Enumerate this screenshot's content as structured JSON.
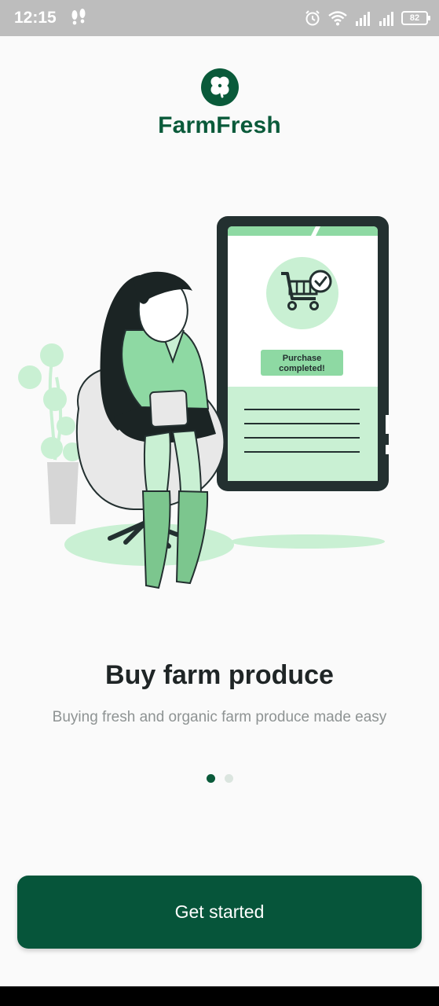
{
  "status_bar": {
    "time": "12:15",
    "battery": "82",
    "icons": [
      "footsteps-icon",
      "alarm-icon",
      "wifi-icon",
      "signal-icon",
      "signal-icon",
      "battery-icon"
    ]
  },
  "brand": {
    "name": "FarmFresh",
    "icon": "clover-icon",
    "color": "#0a5a3a"
  },
  "illustration": {
    "badge_line1": "Purchase",
    "badge_line2": "completed!",
    "icon": "shopping-cart-check-icon"
  },
  "onboarding": {
    "title": "Buy farm produce",
    "subtitle": "Buying fresh and organic farm produce made easy",
    "page_index": 1,
    "page_count": 2
  },
  "cta": {
    "label": "Get started",
    "color": "#06553a"
  }
}
